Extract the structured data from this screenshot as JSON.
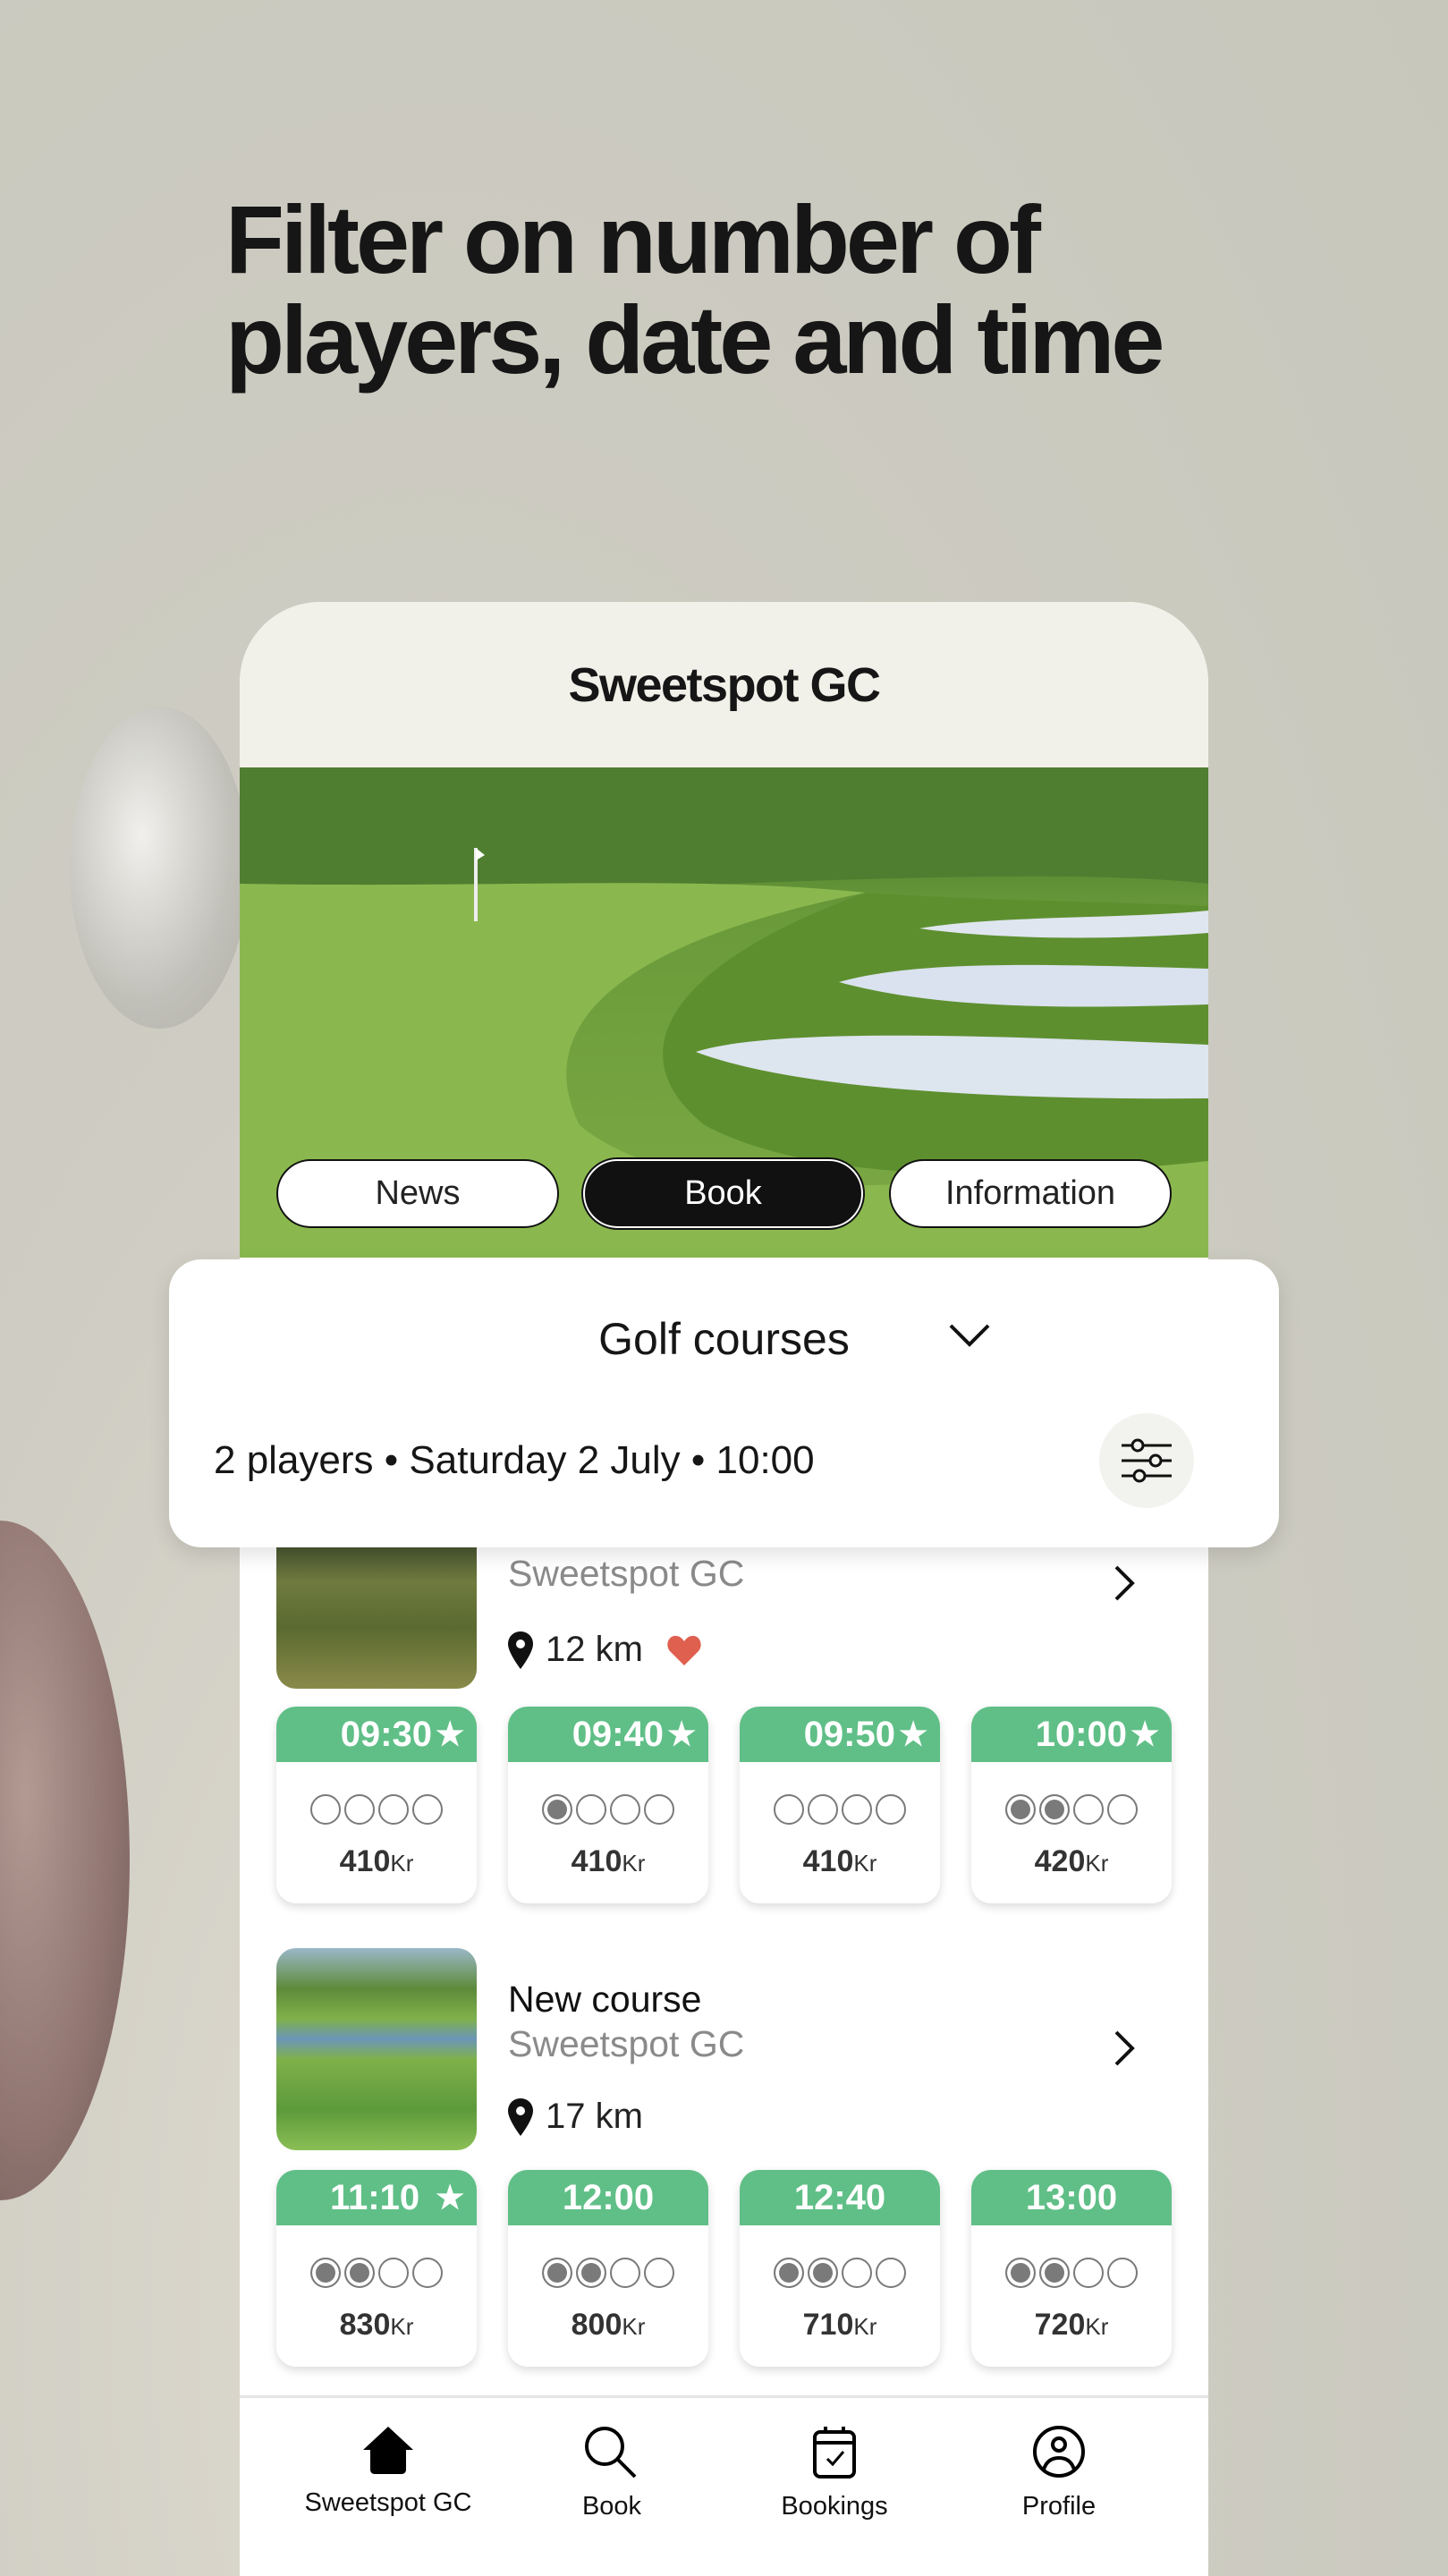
{
  "headline": "Filter on number of players, date and time",
  "app": {
    "title": "Sweetspot GC",
    "tabs": [
      {
        "label": "News",
        "active": false
      },
      {
        "label": "Book",
        "active": true
      },
      {
        "label": "Information",
        "active": false
      }
    ]
  },
  "filter": {
    "title": "Golf courses",
    "summary": "2 players • Saturday 2 July • 10:00"
  },
  "courses": [
    {
      "name": "",
      "club": "Sweetspot GC",
      "distance": "12 km",
      "favorite": true,
      "slots": [
        {
          "time": "09:30",
          "star": true,
          "booked": 0,
          "price": "410",
          "currency": "Kr"
        },
        {
          "time": "09:40",
          "star": true,
          "booked": 1,
          "price": "410",
          "currency": "Kr"
        },
        {
          "time": "09:50",
          "star": true,
          "booked": 0,
          "price": "410",
          "currency": "Kr"
        },
        {
          "time": "10:00",
          "star": true,
          "booked": 2,
          "price": "420",
          "currency": "Kr"
        }
      ]
    },
    {
      "name": "New course",
      "club": "Sweetspot GC",
      "distance": "17 km",
      "favorite": false,
      "slots": [
        {
          "time": "11:10",
          "star": true,
          "booked": 2,
          "price": "830",
          "currency": "Kr"
        },
        {
          "time": "12:00",
          "star": false,
          "booked": 2,
          "price": "800",
          "currency": "Kr"
        },
        {
          "time": "12:40",
          "star": false,
          "booked": 2,
          "price": "710",
          "currency": "Kr"
        },
        {
          "time": "13:00",
          "star": false,
          "booked": 2,
          "price": "720",
          "currency": "Kr"
        }
      ]
    }
  ],
  "nav": [
    {
      "label": "Sweetspot GC",
      "icon": "home-icon",
      "active": true
    },
    {
      "label": "Book",
      "icon": "search-icon"
    },
    {
      "label": "Bookings",
      "icon": "calendar-check-icon"
    },
    {
      "label": "Profile",
      "icon": "profile-icon"
    }
  ],
  "colors": {
    "slot_header": "#60bf87",
    "favorite": "#e0604f",
    "background": "#cbcbc2"
  }
}
